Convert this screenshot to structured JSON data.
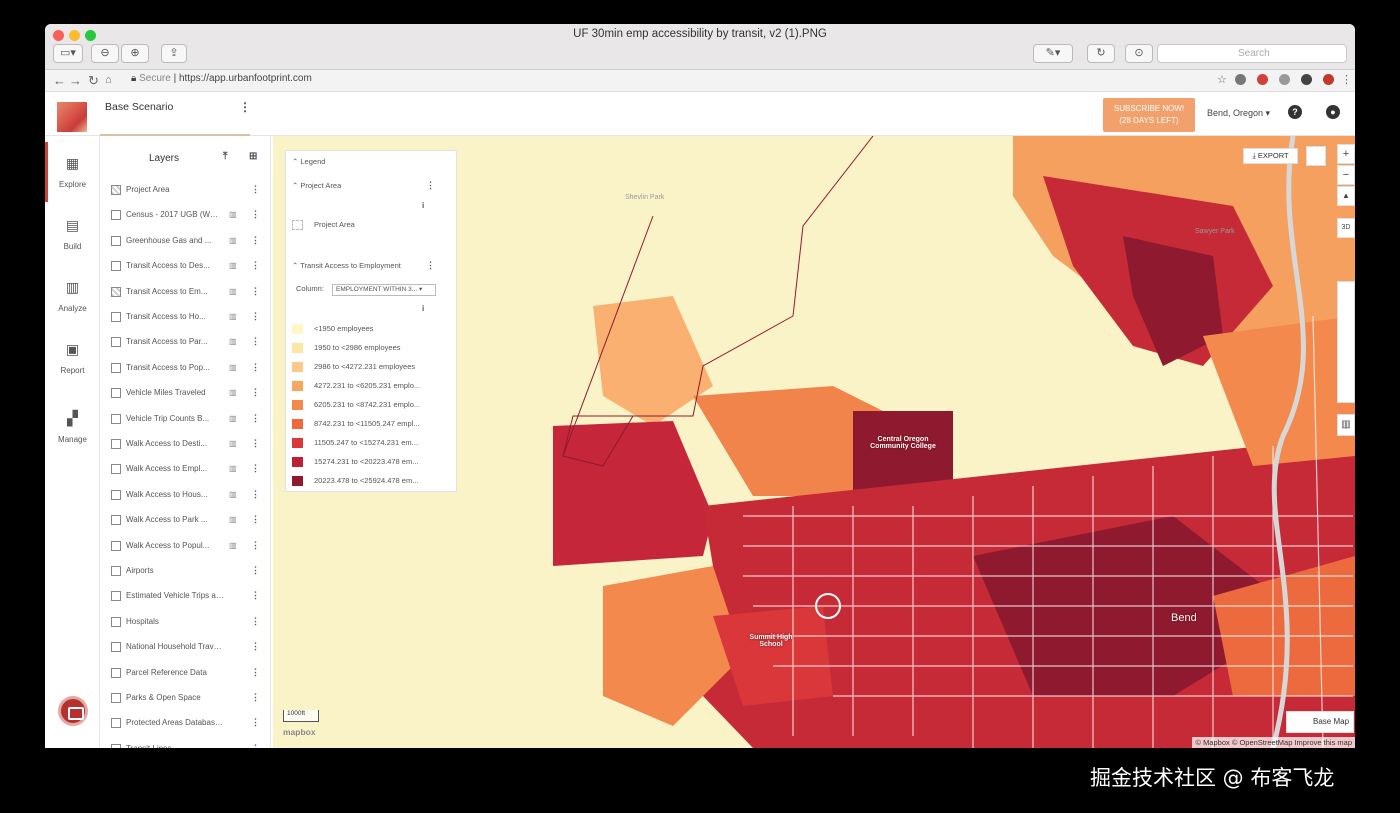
{
  "window": {
    "title": "UF 30min emp accessibility by transit, v2 (1).PNG",
    "search_placeholder": "Search"
  },
  "browser": {
    "secure_label": "Secure",
    "url": "https://app.urbanfootprint.com"
  },
  "app": {
    "scenario": "Base Scenario",
    "subscribe_line1": "SUBSCRIBE NOW!",
    "subscribe_line2": "(28 DAYS LEFT)",
    "location": "Bend, Oregon"
  },
  "rail": [
    {
      "label": "Explore",
      "icon": "grid-icon"
    },
    {
      "label": "Build",
      "icon": "building-icon"
    },
    {
      "label": "Analyze",
      "icon": "bar-chart-icon"
    },
    {
      "label": "Report",
      "icon": "report-icon"
    },
    {
      "label": "Manage",
      "icon": "manage-icon"
    }
  ],
  "layers": {
    "heading": "Layers",
    "items": [
      {
        "name": "Project Area",
        "checked": true,
        "chart": false
      },
      {
        "name": "Census - 2017 UGB (WGS 1...",
        "checked": false,
        "chart": true
      },
      {
        "name": "Greenhouse Gas and ...",
        "checked": false,
        "chart": true
      },
      {
        "name": "Transit Access to Des...",
        "checked": false,
        "chart": true
      },
      {
        "name": "Transit Access to Em...",
        "checked": true,
        "chart": true
      },
      {
        "name": "Transit Access to Ho...",
        "checked": false,
        "chart": true
      },
      {
        "name": "Transit Access to Par...",
        "checked": false,
        "chart": true
      },
      {
        "name": "Transit Access to Pop...",
        "checked": false,
        "chart": true
      },
      {
        "name": "Vehicle Miles Traveled",
        "checked": false,
        "chart": true
      },
      {
        "name": "Vehicle Trip Counts B...",
        "checked": false,
        "chart": true
      },
      {
        "name": "Walk Access to Desti...",
        "checked": false,
        "chart": true
      },
      {
        "name": "Walk Access to Empl...",
        "checked": false,
        "chart": true
      },
      {
        "name": "Walk Access to Hous...",
        "checked": false,
        "chart": true
      },
      {
        "name": "Walk Access to Park ...",
        "checked": false,
        "chart": true
      },
      {
        "name": "Walk Access to Popul...",
        "checked": false,
        "chart": true
      },
      {
        "name": "Airports",
        "checked": false,
        "chart": false
      },
      {
        "name": "Estimated Vehicle Trips an...",
        "checked": false,
        "chart": false
      },
      {
        "name": "Hospitals",
        "checked": false,
        "chart": false
      },
      {
        "name": "National Household Travel ...",
        "checked": false,
        "chart": false
      },
      {
        "name": "Parcel Reference Data",
        "checked": false,
        "chart": false
      },
      {
        "name": "Parks & Open Space",
        "checked": false,
        "chart": false
      },
      {
        "name": "Protected Areas Database (...",
        "checked": false,
        "chart": false
      },
      {
        "name": "Transit Lines",
        "checked": false,
        "chart": false
      }
    ]
  },
  "legend": {
    "title": "Legend",
    "project_area_section": "Project Area",
    "project_area_item": "Project Area",
    "transit_section": "Transit Access to Employment",
    "column_label": "Column:",
    "column_value": "EMPLOYMENT WITHIN 3...",
    "classes": [
      {
        "label": "<1950 employees",
        "color": "#fff7c4"
      },
      {
        "label": "1950 to <2986 employees",
        "color": "#fde7a4"
      },
      {
        "label": "2986 to <4272.231 employees",
        "color": "#fcc98a"
      },
      {
        "label": "4272.231 to <6205.231 emplo...",
        "color": "#f9a65f"
      },
      {
        "label": "6205.231 to <8742.231 emplo...",
        "color": "#f4894d"
      },
      {
        "label": "8742.231 to <11505.247 empl...",
        "color": "#ec6a3e"
      },
      {
        "label": "11505.247 to <15274.231 em...",
        "color": "#d9373a"
      },
      {
        "label": "15274.231 to <20223.478 em...",
        "color": "#bd2034"
      },
      {
        "label": "20223.478 to <25924.478 em...",
        "color": "#8f1a30"
      }
    ]
  },
  "map": {
    "export_label": "EXPORT",
    "zoom_in": "+",
    "zoom_out": "−",
    "three_d": "3D",
    "basemap_label": "Base Map",
    "attribution": "© Mapbox © OpenStreetMap Improve this map",
    "scale_label": "1000ft",
    "mapbox_logo": "mapbox",
    "labels": {
      "college": "Central Oregon Community College",
      "school": "Summit High School",
      "city": "Bend",
      "park": "Shevlin Park",
      "park2": "Sawyer Park"
    }
  },
  "watermark": "掘金技术社区 @ 布客飞龙"
}
